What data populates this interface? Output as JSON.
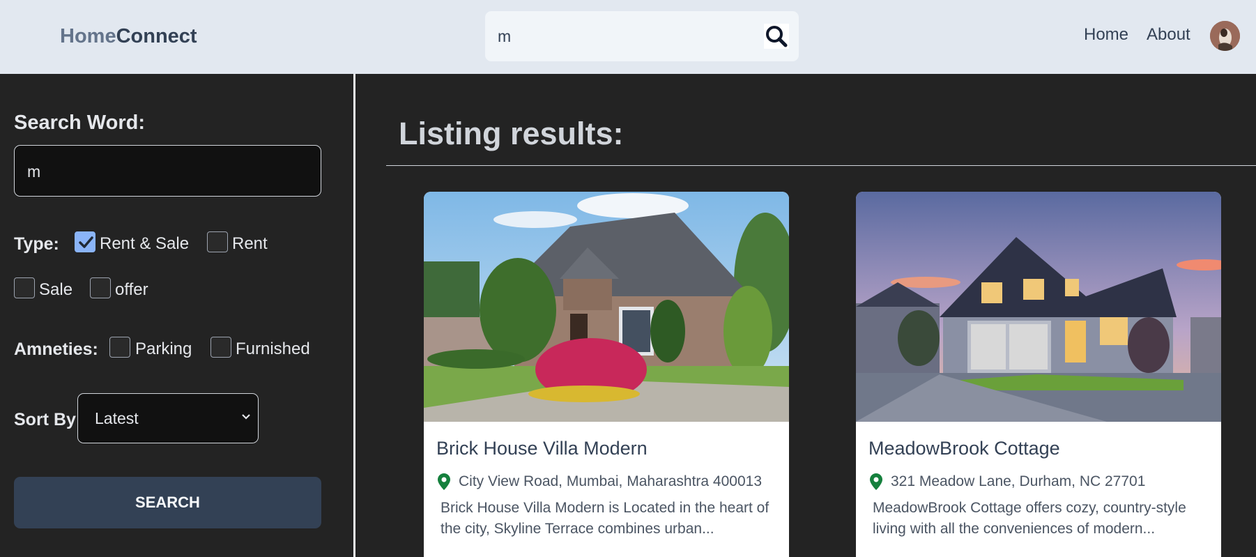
{
  "header": {
    "logo_part1": "Home",
    "logo_part2": "Connect",
    "search_value": "m",
    "nav": [
      "Home",
      "About"
    ]
  },
  "sidebar": {
    "search_label": "Search Word:",
    "search_value": "m",
    "type_label": "Type:",
    "type_options": [
      {
        "label": "Rent & Sale",
        "checked": true
      },
      {
        "label": "Rent",
        "checked": false
      },
      {
        "label": "Sale",
        "checked": false
      },
      {
        "label": "offer",
        "checked": false
      }
    ],
    "amenities_label": "Amneties:",
    "amenities_options": [
      {
        "label": "Parking",
        "checked": false
      },
      {
        "label": "Furnished",
        "checked": false
      }
    ],
    "sort_label": "Sort By",
    "sort_value": "Latest",
    "search_button": "SEARCH"
  },
  "results": {
    "title": "Listing results:",
    "listings": [
      {
        "title": "Brick House Villa Modern",
        "address": "City View Road, Mumbai, Maharashtra 400013",
        "description": "Brick House Villa Modern is Located in the heart of the city, Skyline Terrace combines urban..."
      },
      {
        "title": "MeadowBrook Cottage",
        "address": "321 Meadow Lane, Durham, NC 27701",
        "description": "MeadowBrook Cottage offers cozy, country-style living with all the conveniences of modern..."
      }
    ]
  },
  "colors": {
    "header_bg": "#e2e8f0",
    "page_bg": "#232323",
    "button_bg": "#334155",
    "pin": "#15803d",
    "checkbox_checked": "#8ab4f8"
  }
}
